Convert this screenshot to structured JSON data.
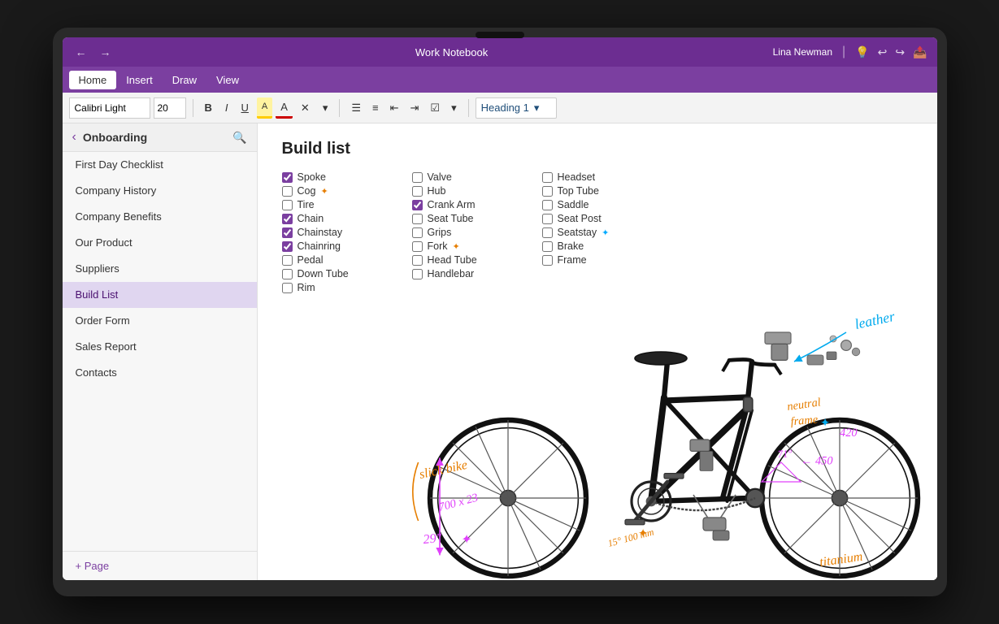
{
  "app": {
    "title": "Work Notebook",
    "user": "Lina Newman"
  },
  "titlebar": {
    "back_arrow": "←",
    "forward_arrow": "→",
    "minimize": "—"
  },
  "menubar": {
    "tabs": [
      "Home",
      "Insert",
      "Draw",
      "View"
    ]
  },
  "toolbar": {
    "font": "Calibri Light",
    "size": "20",
    "bold": "B",
    "italic": "I",
    "underline": "U",
    "heading": "Heading 1",
    "dropdown_arrow": "▾"
  },
  "sidebar": {
    "section": "Onboarding",
    "items": [
      {
        "label": "First Day Checklist",
        "active": false
      },
      {
        "label": "Company History",
        "active": false
      },
      {
        "label": "Company Benefits",
        "active": false
      },
      {
        "label": "Our Product",
        "active": false
      },
      {
        "label": "Suppliers",
        "active": false
      },
      {
        "label": "Build List",
        "active": true
      },
      {
        "label": "Order Form",
        "active": false
      },
      {
        "label": "Sales Report",
        "active": false
      },
      {
        "label": "Contacts",
        "active": false
      }
    ],
    "add_page": "+ Page"
  },
  "page": {
    "title": "Build list",
    "columns": [
      {
        "items": [
          {
            "label": "Spoke",
            "checked": true,
            "annotation": null
          },
          {
            "label": "Cog",
            "checked": false,
            "annotation": "star_orange"
          },
          {
            "label": "Tire",
            "checked": false,
            "annotation": null
          },
          {
            "label": "Chain",
            "checked": true,
            "annotation": null
          },
          {
            "label": "Chainstay",
            "checked": true,
            "annotation": null
          },
          {
            "label": "Chainring",
            "checked": true,
            "annotation": null
          },
          {
            "label": "Pedal",
            "checked": false,
            "annotation": null
          },
          {
            "label": "Down Tube",
            "checked": false,
            "annotation": null
          },
          {
            "label": "Rim",
            "checked": false,
            "annotation": null
          }
        ]
      },
      {
        "items": [
          {
            "label": "Valve",
            "checked": false,
            "annotation": null
          },
          {
            "label": "Hub",
            "checked": false,
            "annotation": null
          },
          {
            "label": "Crank Arm",
            "checked": true,
            "annotation": null
          },
          {
            "label": "Seat Tube",
            "checked": false,
            "annotation": null
          },
          {
            "label": "Grips",
            "checked": false,
            "annotation": null
          },
          {
            "label": "Fork",
            "checked": false,
            "annotation": "star_orange"
          },
          {
            "label": "Head Tube",
            "checked": false,
            "annotation": null
          },
          {
            "label": "Handlebar",
            "checked": false,
            "annotation": null
          }
        ]
      },
      {
        "items": [
          {
            "label": "Headset",
            "checked": false,
            "annotation": null
          },
          {
            "label": "Top Tube",
            "checked": false,
            "annotation": null
          },
          {
            "label": "Saddle",
            "checked": false,
            "annotation": null
          },
          {
            "label": "Seat Post",
            "checked": false,
            "annotation": null
          },
          {
            "label": "Seatstay",
            "checked": false,
            "annotation": "star_blue"
          },
          {
            "label": "Brake",
            "checked": false,
            "annotation": null
          },
          {
            "label": "Frame",
            "checked": false,
            "annotation": null
          }
        ]
      }
    ]
  },
  "annotations": {
    "leather": "leather",
    "neutral_frame": "neutral frame",
    "slick_bike": "slick bike",
    "size": "700 x 23",
    "wheel_size": "29\"",
    "titanium": "titanium",
    "dim_420": "420",
    "dim_450": "450",
    "dim_710": "71°",
    "dim_100mm": "15° 100 mm"
  }
}
